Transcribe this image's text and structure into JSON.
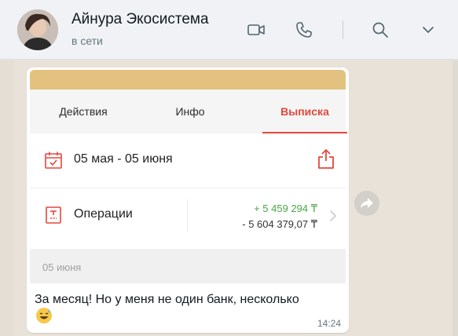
{
  "contact": {
    "name": "Айнура Экосистема",
    "status": "в сети"
  },
  "header_icons": [
    "video-call-icon",
    "phone-icon",
    "search-icon",
    "chevron-down-icon"
  ],
  "card": {
    "tabs": [
      {
        "label": "Действия",
        "active": false
      },
      {
        "label": "Инфо",
        "active": false
      },
      {
        "label": "Выписка",
        "active": true
      }
    ],
    "period": {
      "label": "05 мая - 05 июня",
      "icon": "calendar-icon",
      "action_icon": "share-icon"
    },
    "operations": {
      "label": "Операции",
      "icon": "receipt-icon",
      "incoming": "+ 5 459 294 ₸",
      "outgoing": "- 5 604 379,07 ₸"
    },
    "date": "05 июня"
  },
  "message": {
    "text": "За месяц! Но у меня не один банк, несколько",
    "emoji": "grinning-sweat-emoji",
    "time": "14:24"
  },
  "colors": {
    "accent": "#e2483d",
    "incoming_green": "#4aa64a",
    "banner": "#e2c27e",
    "chat_bg": "#e8e2d9"
  }
}
